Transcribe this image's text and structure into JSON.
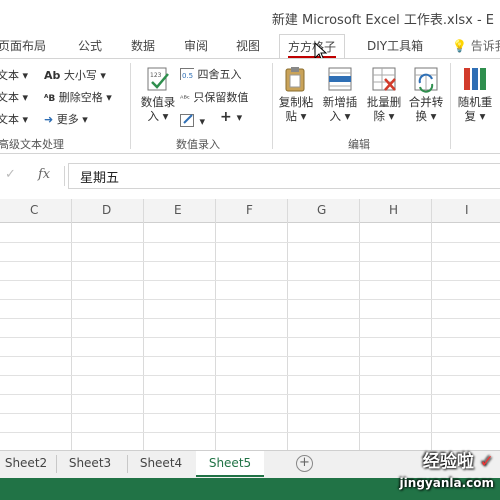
{
  "window": {
    "title": "新建 Microsoft Excel 工作表.xlsx - E"
  },
  "tabs": [
    {
      "label": "页面布局",
      "active": false
    },
    {
      "label": "公式",
      "active": false
    },
    {
      "label": "数据",
      "active": false
    },
    {
      "label": "审阅",
      "active": false
    },
    {
      "label": "视图",
      "active": false
    },
    {
      "label": "方方格子",
      "active": true
    },
    {
      "label": "DIY工具箱",
      "active": false
    }
  ],
  "tell_me": "告诉我",
  "ribbon": {
    "text_group": {
      "rows": [
        "文本",
        "文本",
        "文本"
      ],
      "case_label": "大小写",
      "remove_space_label": "删除空格",
      "more_label": "更多",
      "group_label": "高级文本处理"
    },
    "number_group": {
      "numeric_entry": {
        "line1": "数值录",
        "line2": "入"
      },
      "round_label": "四舍五入",
      "keep_values_label": "只保留数值",
      "group_label": "数值录入"
    },
    "edit_group": {
      "copy_paste": {
        "line1": "复制粘",
        "line2": "贴"
      },
      "insert": {
        "line1": "新增插",
        "line2": "入"
      },
      "batch_delete": {
        "line1": "批量删",
        "line2": "除"
      },
      "merge_convert": {
        "line1": "合并转",
        "line2": "换"
      },
      "random_repeat": {
        "line1": "随机重",
        "line2": "复"
      },
      "group_label": "编辑"
    }
  },
  "formula_bar": {
    "fx_label": "fx",
    "value": "星期五"
  },
  "columns": [
    "C",
    "D",
    "E",
    "F",
    "G",
    "H",
    "I"
  ],
  "sheets": [
    {
      "label": "Sheet2",
      "active": false
    },
    {
      "label": "Sheet3",
      "active": false
    },
    {
      "label": "Sheet4",
      "active": false
    },
    {
      "label": "Sheet5",
      "active": true
    }
  ],
  "watermark": {
    "main": "经验啦",
    "sub": "jingyanla.com"
  },
  "colors": {
    "accent_green": "#217346",
    "active_tab_underline": "#c00000"
  }
}
